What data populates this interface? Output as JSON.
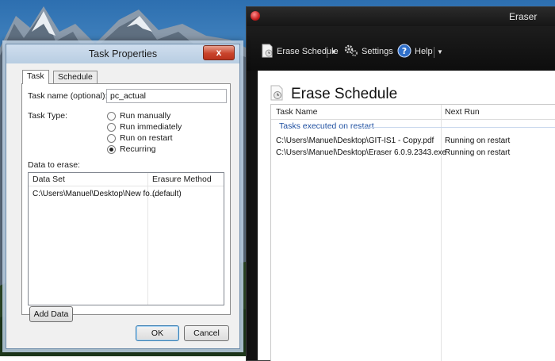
{
  "eraser": {
    "title": "Eraser",
    "toolbar": {
      "erase_schedule": "Erase Schedule",
      "settings": "Settings",
      "help": "Help"
    },
    "page_title": "Erase Schedule",
    "list": {
      "columns": [
        "Task Name",
        "Next Run"
      ],
      "group": "Tasks executed on restart",
      "rows": [
        {
          "name": "C:\\Users\\Manuel\\Desktop\\GIT-IS1 - Copy.pdf",
          "next_run": "Running on restart"
        },
        {
          "name": "C:\\Users\\Manuel\\Desktop\\Eraser 6.0.9.2343.exe",
          "next_run": "Running on restart"
        }
      ]
    }
  },
  "dialog": {
    "title": "Task Properties",
    "close_label": "x",
    "tabs": [
      "Task",
      "Schedule"
    ],
    "task_name_label": "Task name (optional):",
    "task_name_value": "pc_actual",
    "task_type_label": "Task Type:",
    "task_types": [
      "Run manually",
      "Run immediately",
      "Run on restart",
      "Recurring"
    ],
    "selected_task_type": "Recurring",
    "data_label": "Data to erase:",
    "data_columns": [
      "Data Set",
      "Erasure Method"
    ],
    "data_rows": [
      {
        "data_set": "C:\\Users\\Manuel\\Desktop\\New fo...",
        "method": "(default)"
      }
    ],
    "add_data": "Add Data",
    "ok": "OK",
    "cancel": "Cancel"
  },
  "colors": {
    "eraser_background": "#121212",
    "group_header_text": "#1e4fa0",
    "dialog_frame": "#b8cde2",
    "close_button": "#c9442b"
  },
  "icons": [
    "eraser-app-icon",
    "erase-schedule-icon",
    "settings-gear-icon",
    "help-icon",
    "chevron-down-icon",
    "schedule-page-icon"
  ]
}
